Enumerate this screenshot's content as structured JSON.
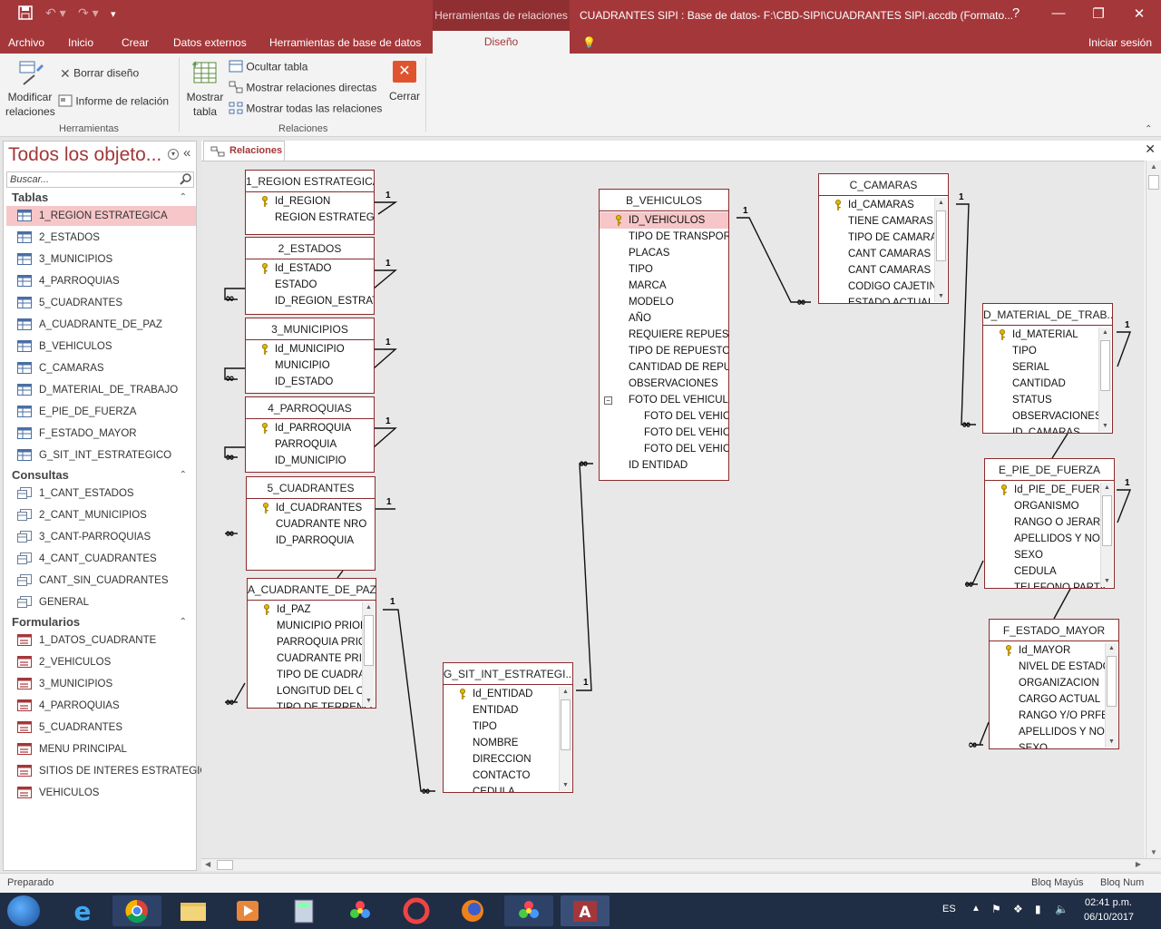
{
  "window": {
    "context_tab_header": "Herramientas de relaciones",
    "title": "CUADRANTES SIPI : Base de datos- F:\\CBD-SIPI\\CUADRANTES SIPI.accdb (Formato...",
    "help": "?",
    "minimize": "—",
    "restore": "❐",
    "close": "✕"
  },
  "ribbon_tabs": {
    "archivo": "Archivo",
    "inicio": "Inicio",
    "crear": "Crear",
    "datos_externos": "Datos externos",
    "herramientas_bd": "Herramientas de base de datos",
    "diseno": "Diseño",
    "tell_me": "💡",
    "signin": "Iniciar sesión"
  },
  "ribbon": {
    "modificar_line1": "Modificar",
    "modificar_line2": "relaciones",
    "borrar_diseno": "Borrar diseño",
    "informe": "Informe de relación",
    "group_herramientas": "Herramientas",
    "mostrar_tabla_line1": "Mostrar",
    "mostrar_tabla_line2": "tabla",
    "ocultar_tabla": "Ocultar tabla",
    "mostrar_directas": "Mostrar relaciones directas",
    "mostrar_todas": "Mostrar todas las relaciones",
    "cerrar": "Cerrar",
    "group_relaciones": "Relaciones",
    "collapse": "⌃"
  },
  "nav": {
    "title": "Todos los objeto...",
    "search_placeholder": "Buscar...",
    "sections": {
      "tablas": "Tablas",
      "consultas": "Consultas",
      "formularios": "Formularios"
    },
    "tablas": [
      "1_REGION ESTRATEGICA",
      "2_ESTADOS",
      "3_MUNICIPIOS",
      "4_PARROQUIAS",
      "5_CUADRANTES",
      "A_CUADRANTE_DE_PAZ",
      "B_VEHICULOS",
      "C_CAMARAS",
      "D_MATERIAL_DE_TRABAJO",
      "E_PIE_DE_FUERZA",
      "F_ESTADO_MAYOR",
      "G_SIT_INT_ESTRATEGICO"
    ],
    "consultas": [
      "1_CANT_ESTADOS",
      "2_CANT_MUNICIPIOS",
      "3_CANT-PARROQUIAS",
      "4_CANT_CUADRANTES",
      "CANT_SIN_CUADRANTES",
      "GENERAL"
    ],
    "formularios": [
      "1_DATOS_CUADRANTE",
      "2_VEHICULOS",
      "3_MUNICIPIOS",
      "4_PARROQUIAS",
      "5_CUADRANTES",
      "MENU PRINCIPAL",
      "SITIOS DE INTERES ESTRATEGICO",
      "VEHICULOS"
    ]
  },
  "document": {
    "tab_label": "Relaciones",
    "close": "✕"
  },
  "tables": {
    "region": {
      "title": "1_REGION ESTRATEGICA",
      "fields": [
        "Id_REGION",
        "REGION ESTRATEGICA"
      ]
    },
    "estados": {
      "title": "2_ESTADOS",
      "fields": [
        "Id_ESTADO",
        "ESTADO",
        "ID_REGION_ESTRATEG"
      ]
    },
    "municipios": {
      "title": "3_MUNICIPIOS",
      "fields": [
        "Id_MUNICIPIO",
        "MUNICIPIO",
        "ID_ESTADO"
      ]
    },
    "parroquias": {
      "title": "4_PARROQUIAS",
      "fields": [
        "Id_PARROQUIA",
        "PARROQUIA",
        "ID_MUNICIPIO"
      ]
    },
    "cuadrantes": {
      "title": "5_CUADRANTES",
      "fields": [
        "Id_CUADRANTES",
        "CUADRANTE NRO",
        "ID_PARROQUIA"
      ]
    },
    "paz": {
      "title": "A_CUADRANTE_DE_PAZ",
      "fields": [
        "Id_PAZ",
        "MUNICIPIO PRIOR",
        "PARROQUIA PRIOI",
        "CUADRANTE PRIOI",
        "TIPO DE CUADRAN",
        "LONGITUD DEL CU",
        "TIPO DE TERRENO"
      ]
    },
    "vehiculos": {
      "title": "B_VEHICULOS",
      "fields": [
        "ID_VEHICULOS",
        "TIPO DE TRANSPORTE",
        "PLACAS",
        "TIPO",
        "MARCA",
        "MODELO",
        "AÑO",
        "REQUIERE REPUESTOS",
        "TIPO DE REPUESTOS",
        "CANTIDAD DE REPUES",
        "OBSERVACIONES",
        "FOTO DEL VEHICULO",
        "FOTO DEL VEHICU",
        "FOTO DEL VEHICU",
        "FOTO DEL VEHICU",
        "ID ENTIDAD"
      ]
    },
    "camaras": {
      "title": "C_CAMARAS",
      "fields": [
        "Id_CAMARAS",
        "TIENE CAMARAS",
        "TIPO DE CAMARA",
        "CANT CAMARAS FI",
        "CANT CAMARAS D",
        "CODIGO CAJETIN",
        "ESTADO ACTUAL"
      ]
    },
    "material": {
      "title": "D_MATERIAL_DE_TRAB...",
      "fields": [
        "Id_MATERIAL",
        "TIPO",
        "SERIAL",
        "CANTIDAD",
        "STATUS",
        "OBSERVACIONES",
        "ID_CAMARAS"
      ]
    },
    "pie": {
      "title": "E_PIE_DE_FUERZA",
      "fields": [
        "Id_PIE_DE_FUERZA",
        "ORGANISMO",
        "RANGO O JERARQ",
        "APELLIDOS Y NOM",
        "SEXO",
        "CEDULA",
        "TELEFONO PARTIC"
      ]
    },
    "mayor": {
      "title": "F_ESTADO_MAYOR",
      "fields": [
        "Id_MAYOR",
        "NIVEL DE ESTADO",
        "ORGANIZACION",
        "CARGO ACTUAL",
        "RANGO Y/O PRFES",
        "APELLIDOS Y NOM",
        "SEXO"
      ]
    },
    "sit": {
      "title": "G_SIT_INT_ESTRATEGI...",
      "fields": [
        "Id_ENTIDAD",
        "ENTIDAD",
        "TIPO",
        "NOMBRE",
        "DIRECCION",
        "CONTACTO",
        "CEDULA"
      ]
    }
  },
  "rel_marks": {
    "one": "1",
    "many": "∞"
  },
  "status": {
    "left": "Preparado",
    "caps": "Bloq Mayús",
    "num": "Bloq Num"
  },
  "taskbar": {
    "lang": "ES",
    "time": "02:41 p.m.",
    "date": "06/10/2017"
  },
  "colors": {
    "accent": "#a4373a",
    "selection": "#f6c6c8",
    "taskbar": "#1f2d45"
  }
}
